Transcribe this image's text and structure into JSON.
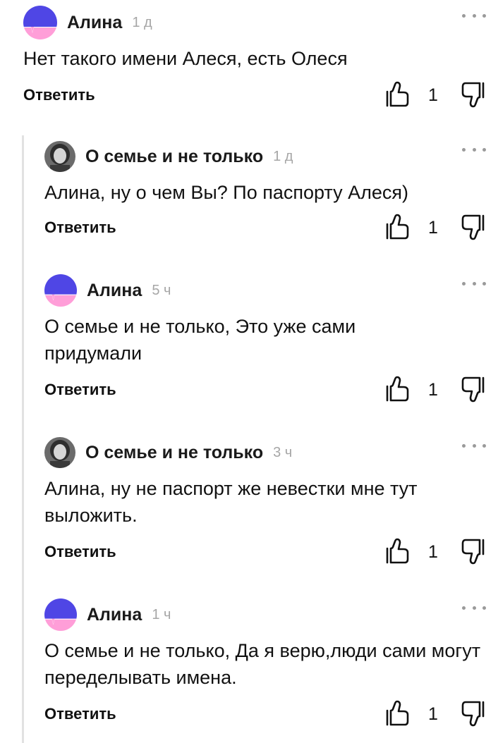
{
  "colors": {
    "accent_blue": "#4f46e5",
    "accent_pink": "#ff9ed8",
    "thread_line": "#e2e2e2",
    "timestamp": "#a6a6a6"
  },
  "comments": [
    {
      "author": "Алина",
      "time": "1 д",
      "text": "Нет такого имени Алеся, есть Олеся",
      "reply_label": "Ответить",
      "likes": "1",
      "avatar_icon": "blue-pink-logo-avatar"
    },
    {
      "author": "О семье и не только",
      "time": "1 д",
      "text": "Алина, ну о чем Вы? По паспорту Алеся)",
      "reply_label": "Ответить",
      "likes": "1",
      "avatar_icon": "photo-avatar"
    },
    {
      "author": "Алина",
      "time": "5 ч",
      "text": "О семье и не только, Это уже сами придумали",
      "reply_label": "Ответить",
      "likes": "1",
      "avatar_icon": "blue-pink-logo-avatar"
    },
    {
      "author": "О семье и не только",
      "time": "3 ч",
      "text": "Алина, ну не паспорт же невестки мне тут выложить.",
      "reply_label": "Ответить",
      "likes": "1",
      "avatar_icon": "photo-avatar"
    },
    {
      "author": "Алина",
      "time": "1 ч",
      "text": "О семье и не только, Да я верю,люди сами могут переделывать имена.",
      "reply_label": "Ответить",
      "likes": "1",
      "avatar_icon": "blue-pink-logo-avatar"
    }
  ]
}
